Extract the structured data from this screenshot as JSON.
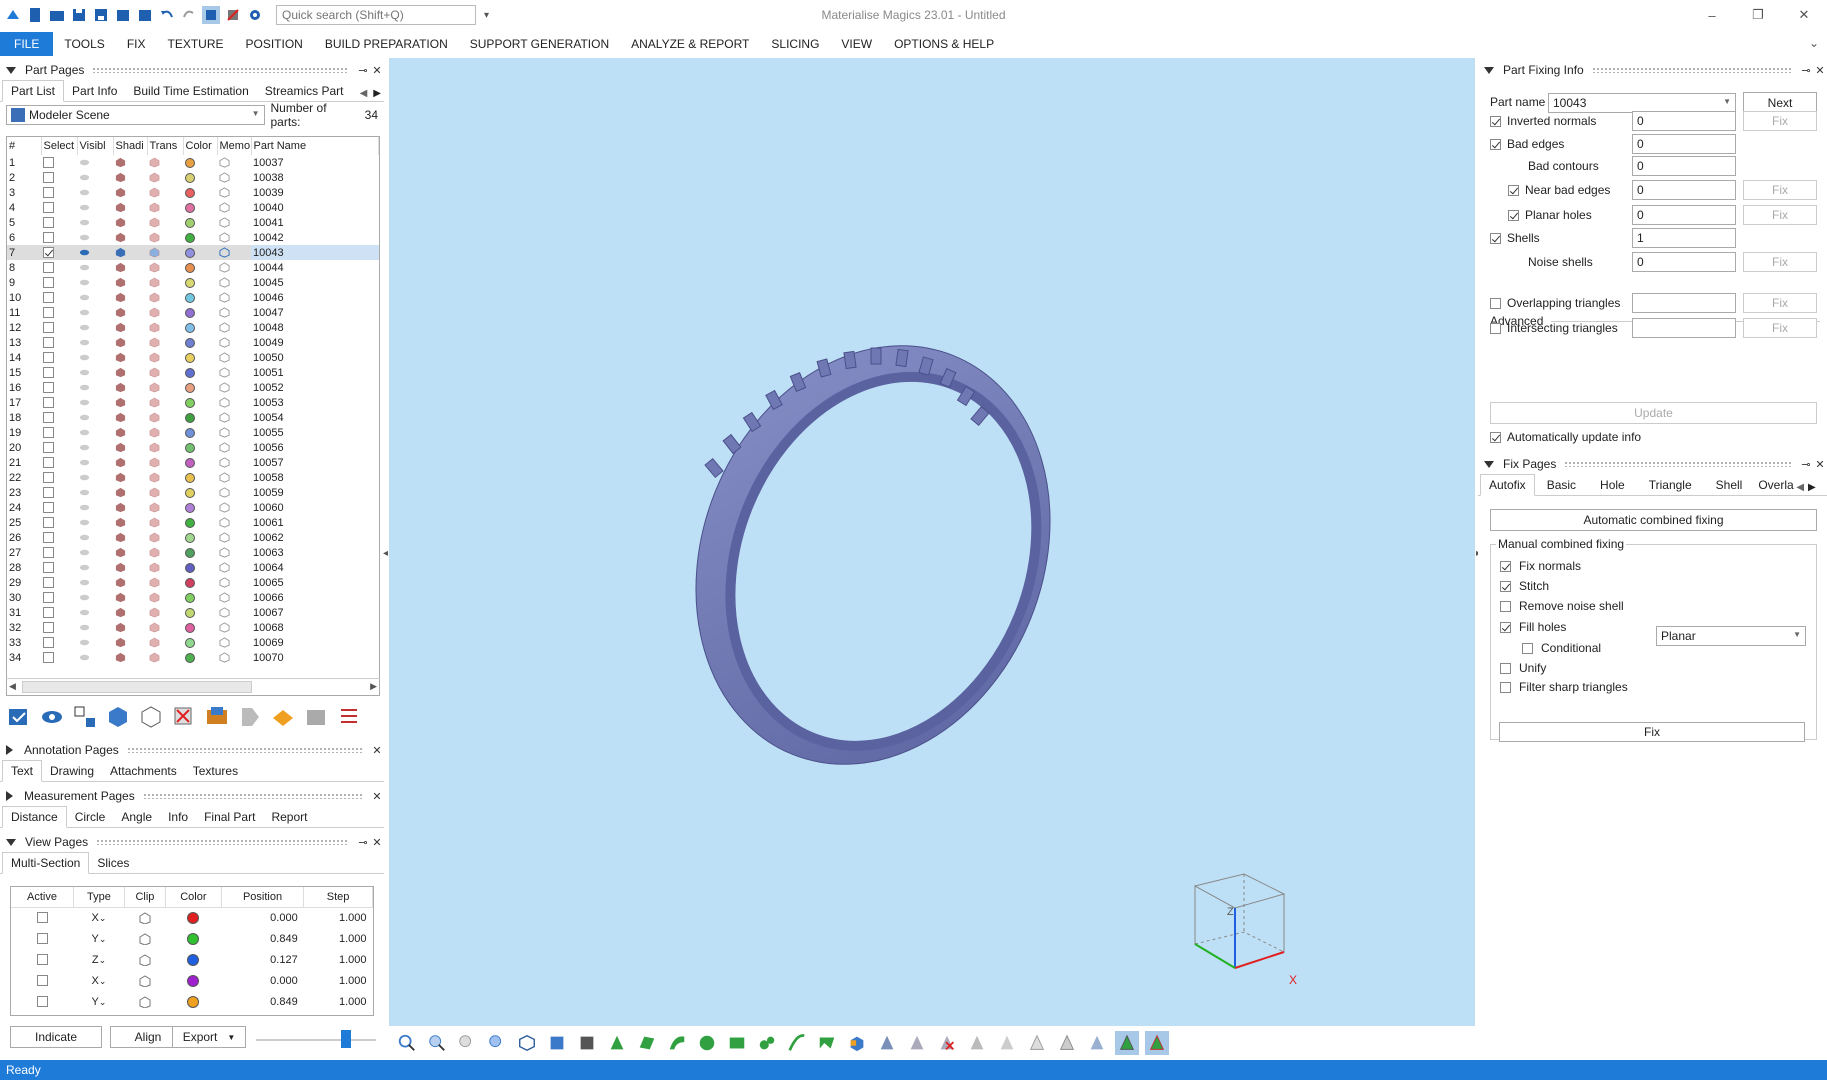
{
  "app": {
    "title": "Materialise Magics 23.01 - Untitled",
    "search_placeholder": "Quick search (Shift+Q)",
    "status": "Ready",
    "window_controls": [
      "minimize-icon",
      "restore-icon",
      "close-icon"
    ]
  },
  "menu": [
    "FILE",
    "TOOLS",
    "FIX",
    "TEXTURE",
    "POSITION",
    "BUILD PREPARATION",
    "SUPPORT GENERATION",
    "ANALYZE & REPORT",
    "SLICING",
    "VIEW",
    "OPTIONS & HELP"
  ],
  "part_pages": {
    "title": "Part Pages",
    "tabs": [
      "Part List",
      "Part Info",
      "Build Time Estimation",
      "Streamics Part"
    ],
    "scene": "Modeler Scene",
    "num_parts_label": "Number of parts:",
    "num_parts": "34",
    "columns": [
      "#",
      "Select",
      "Visibl",
      "Shadi",
      "Trans",
      "Color",
      "Memo",
      "Part Name"
    ],
    "selected_row": 7,
    "rows": [
      {
        "n": "1",
        "name": "10037",
        "color": "#e8a040"
      },
      {
        "n": "2",
        "name": "10038",
        "color": "#d8d070"
      },
      {
        "n": "3",
        "name": "10039",
        "color": "#e86060"
      },
      {
        "n": "4",
        "name": "10040",
        "color": "#e070a0"
      },
      {
        "n": "5",
        "name": "10041",
        "color": "#a0d070"
      },
      {
        "n": "6",
        "name": "10042",
        "color": "#40b040"
      },
      {
        "n": "7",
        "name": "10043",
        "color": "#9090e0"
      },
      {
        "n": "8",
        "name": "10044",
        "color": "#e89050"
      },
      {
        "n": "9",
        "name": "10045",
        "color": "#d8d870"
      },
      {
        "n": "10",
        "name": "10046",
        "color": "#70c8e0"
      },
      {
        "n": "11",
        "name": "10047",
        "color": "#9070d0"
      },
      {
        "n": "12",
        "name": "10048",
        "color": "#80c0e8"
      },
      {
        "n": "13",
        "name": "10049",
        "color": "#7080d0"
      },
      {
        "n": "14",
        "name": "10050",
        "color": "#e8d060"
      },
      {
        "n": "15",
        "name": "10051",
        "color": "#6070d0"
      },
      {
        "n": "16",
        "name": "10052",
        "color": "#e8a080"
      },
      {
        "n": "17",
        "name": "10053",
        "color": "#80d060"
      },
      {
        "n": "18",
        "name": "10054",
        "color": "#40a040"
      },
      {
        "n": "19",
        "name": "10055",
        "color": "#7090d8"
      },
      {
        "n": "20",
        "name": "10056",
        "color": "#70c070"
      },
      {
        "n": "21",
        "name": "10057",
        "color": "#c060c0"
      },
      {
        "n": "22",
        "name": "10058",
        "color": "#e8c050"
      },
      {
        "n": "23",
        "name": "10059",
        "color": "#e0d060"
      },
      {
        "n": "24",
        "name": "10060",
        "color": "#b080d8"
      },
      {
        "n": "25",
        "name": "10061",
        "color": "#40b040"
      },
      {
        "n": "26",
        "name": "10062",
        "color": "#a0d890"
      },
      {
        "n": "27",
        "name": "10063",
        "color": "#50a060"
      },
      {
        "n": "28",
        "name": "10064",
        "color": "#6060c0"
      },
      {
        "n": "29",
        "name": "10065",
        "color": "#d04060"
      },
      {
        "n": "30",
        "name": "10066",
        "color": "#80d060"
      },
      {
        "n": "31",
        "name": "10067",
        "color": "#c0d870"
      },
      {
        "n": "32",
        "name": "10068",
        "color": "#e060a0"
      },
      {
        "n": "33",
        "name": "10069",
        "color": "#90d890"
      },
      {
        "n": "34",
        "name": "10070",
        "color": "#50b050"
      }
    ]
  },
  "annotation_pages": {
    "title": "Annotation Pages",
    "tabs": [
      "Text",
      "Drawing",
      "Attachments",
      "Textures"
    ]
  },
  "measurement_pages": {
    "title": "Measurement Pages",
    "tabs": [
      "Distance",
      "Circle",
      "Angle",
      "Info",
      "Final Part",
      "Report"
    ]
  },
  "view_pages": {
    "title": "View Pages",
    "tabs": [
      "Multi-Section",
      "Slices"
    ],
    "columns": [
      "Active",
      "Type",
      "Clip",
      "Color",
      "Position",
      "Step"
    ],
    "rows": [
      {
        "type": "X",
        "color": "#e02020",
        "position": "0.000",
        "step": "1.000"
      },
      {
        "type": "Y",
        "color": "#30c030",
        "position": "0.849",
        "step": "1.000"
      },
      {
        "type": "Z",
        "color": "#2060e0",
        "position": "0.127",
        "step": "1.000"
      },
      {
        "type": "X",
        "color": "#a020d0",
        "position": "0.000",
        "step": "1.000"
      },
      {
        "type": "Y",
        "color": "#f0a020",
        "position": "0.849",
        "step": "1.000"
      }
    ],
    "buttons": {
      "indicate": "Indicate",
      "align": "Align",
      "export": "Export"
    },
    "slider_level": 0.77
  },
  "part_fixing": {
    "title": "Part Fixing Info",
    "part_name_label": "Part name",
    "part_name": "10043",
    "next": "Next",
    "items": [
      {
        "label": "Inverted normals",
        "checked": true,
        "value": "0",
        "fix": "Fix",
        "fix_enabled": false,
        "indent": 0
      },
      {
        "label": "Bad edges",
        "checked": true,
        "value": "0",
        "fix": "",
        "indent": 0
      },
      {
        "label": "Bad contours",
        "checked": null,
        "value": "0",
        "fix": "",
        "indent": 1
      },
      {
        "label": "Near bad edges",
        "checked": true,
        "value": "0",
        "fix": "Fix",
        "fix_enabled": false,
        "indent": 1
      },
      {
        "label": "Planar holes",
        "checked": true,
        "value": "0",
        "fix": "Fix",
        "fix_enabled": false,
        "indent": 1
      },
      {
        "label": "Shells",
        "checked": true,
        "value": "1",
        "fix": "",
        "indent": 0
      },
      {
        "label": "Noise shells",
        "checked": null,
        "value": "0",
        "fix": "Fix",
        "fix_enabled": false,
        "indent": 1
      }
    ],
    "advanced_label": "Advanced",
    "advanced": [
      {
        "label": "Overlapping triangles",
        "checked": false,
        "value": "",
        "fix": "Fix"
      },
      {
        "label": "Intersecting triangles",
        "checked": false,
        "value": "",
        "fix": "Fix"
      }
    ],
    "update": "Update",
    "auto_update": "Automatically update info"
  },
  "fix_pages": {
    "title": "Fix Pages",
    "tabs": [
      "Autofix",
      "Basic",
      "Hole",
      "Triangle",
      "Shell",
      "Overla"
    ],
    "auto_combined": "Automatic combined fixing",
    "manual_label": "Manual combined fixing",
    "options": [
      {
        "label": "Fix normals",
        "checked": true,
        "indent": 0
      },
      {
        "label": "Stitch",
        "checked": true,
        "indent": 0
      },
      {
        "label": "Remove noise shell",
        "checked": false,
        "indent": 0
      },
      {
        "label": "Fill holes",
        "checked": true,
        "indent": 0
      },
      {
        "label": "Conditional",
        "checked": false,
        "indent": 1
      },
      {
        "label": "Unify",
        "checked": false,
        "indent": 0
      },
      {
        "label": "Filter sharp triangles",
        "checked": false,
        "indent": 0
      }
    ],
    "fill_mode": "Planar",
    "fix_button": "Fix"
  },
  "viewport": {
    "background": "#bee0f6",
    "model_color": "#7880b8",
    "axis_z": "Z",
    "axis_x": "X"
  },
  "colors": {
    "accent": "#1e7bd8"
  }
}
